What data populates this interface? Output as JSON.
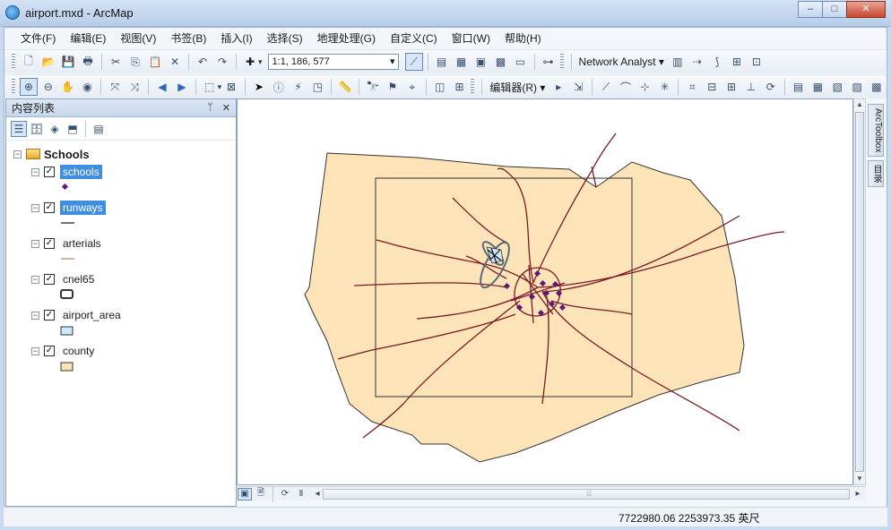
{
  "window": {
    "title": "airport.mxd - ArcMap",
    "minimize": "‒",
    "maximize": "□",
    "close": "✕"
  },
  "menu": [
    "文件(F)",
    "编辑(E)",
    "视图(V)",
    "书签(B)",
    "插入(I)",
    "选择(S)",
    "地理处理(G)",
    "自定义(C)",
    "窗口(W)",
    "帮助(H)"
  ],
  "toolbar": {
    "scale": "1:1, 186, 577",
    "network_analyst": "Network Analyst",
    "editor": "编辑器(R)"
  },
  "toc": {
    "title": "内容列表",
    "pin": "ᛘ",
    "close": "✕",
    "group": "Schools",
    "layers": [
      {
        "name": "schools",
        "checked": true,
        "highlight": true,
        "symbol": "point"
      },
      {
        "name": "runways",
        "checked": true,
        "highlight": true,
        "symbol": "line-black"
      },
      {
        "name": "arterials",
        "checked": true,
        "highlight": false,
        "symbol": "line-tan"
      },
      {
        "name": "cnel65",
        "checked": true,
        "highlight": false,
        "symbol": "poly-outline"
      },
      {
        "name": "airport_area",
        "checked": true,
        "highlight": false,
        "symbol": "poly-blue"
      },
      {
        "name": "county",
        "checked": true,
        "highlight": false,
        "symbol": "poly-tan"
      }
    ],
    "check_mark": "✓",
    "collapse": "−"
  },
  "colors": {
    "county_fill": "#fce3b8",
    "county_stroke": "#333333",
    "arterials": "#7a1a24",
    "schools": "#5b1a7a",
    "cnel65": "#5a6a7a",
    "airport_area": "#cde8f8",
    "highlight": "#3f8ee0"
  },
  "status": {
    "coordinates": "7722980.06  2253973.35 英尺"
  },
  "dock": [
    "ArcToolbox",
    "目录"
  ]
}
